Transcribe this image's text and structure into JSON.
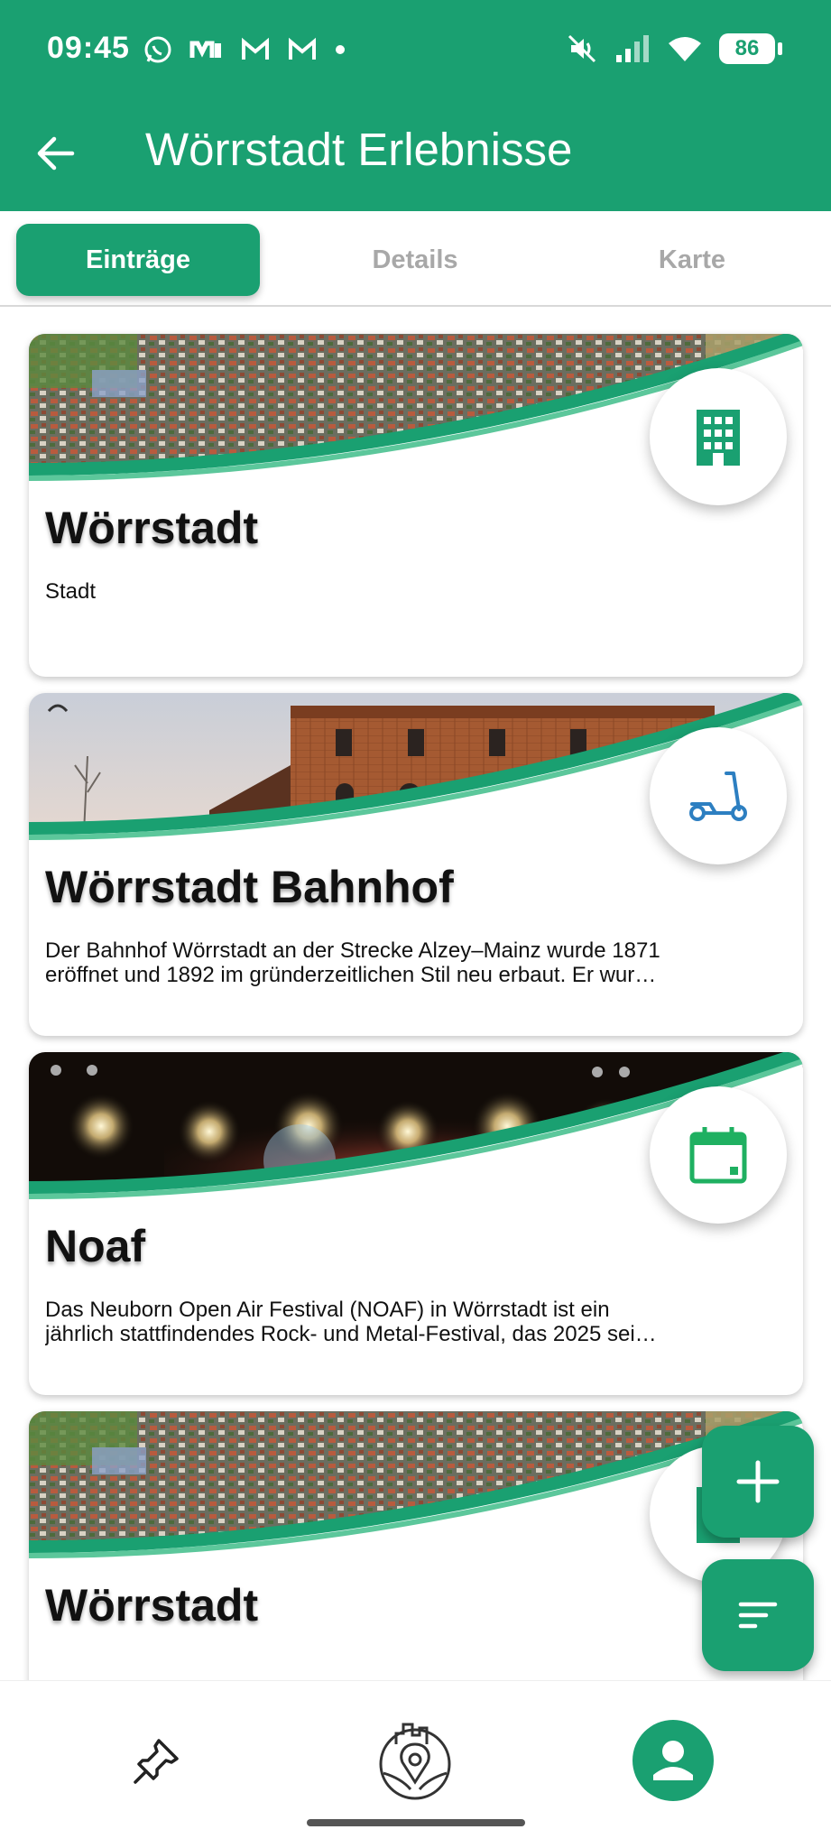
{
  "status_bar": {
    "time": "09:45",
    "battery": "86",
    "left_icons": [
      "whatsapp-icon",
      "mail-icon",
      "gmail-icon",
      "gmail-icon",
      "dot-icon"
    ],
    "right_icons": [
      "mute-icon",
      "signal-icon",
      "wifi-icon"
    ]
  },
  "app_bar": {
    "title": "Wörrstadt Erlebnisse",
    "back_icon": "arrow-left-icon"
  },
  "tabs": [
    {
      "label": "Einträge",
      "active": true
    },
    {
      "label": "Details",
      "active": false
    },
    {
      "label": "Karte",
      "active": false
    }
  ],
  "cards": [
    {
      "title": "Wörrstadt",
      "desc_lines": [
        "Stadt"
      ],
      "icon": "building-icon",
      "image": "aerial-town"
    },
    {
      "title": "Wörrstadt Bahnhof",
      "desc_lines": [
        "Der Bahnhof Wörrstadt an der Strecke Alzey–Mainz wurde 1871",
        "eröffnet und 1892 im gründerzeitlichen Stil neu erbaut. Er wur…"
      ],
      "icon": "scooter-icon",
      "image": "station-building"
    },
    {
      "title": "Noaf",
      "desc_lines": [
        "Das Neuborn Open Air Festival (NOAF) in Wörrstadt ist ein",
        "jährlich stattfindendes Rock- und Metal-Festival, das 2025 sei…"
      ],
      "icon": "calendar-icon",
      "image": "concert-stage"
    },
    {
      "title": "Wörrstadt",
      "desc_lines": [],
      "icon": "building-icon",
      "image": "aerial-town"
    }
  ],
  "fabs": {
    "add_icon": "plus-icon",
    "sort_icon": "sort-icon"
  },
  "bottom_nav": {
    "items": [
      "pin-icon",
      "city-map-icon",
      "profile-icon"
    ]
  },
  "colors": {
    "primary": "#1aa071",
    "accent_light": "#5cc79b",
    "scooter_blue": "#2d7fc1"
  }
}
